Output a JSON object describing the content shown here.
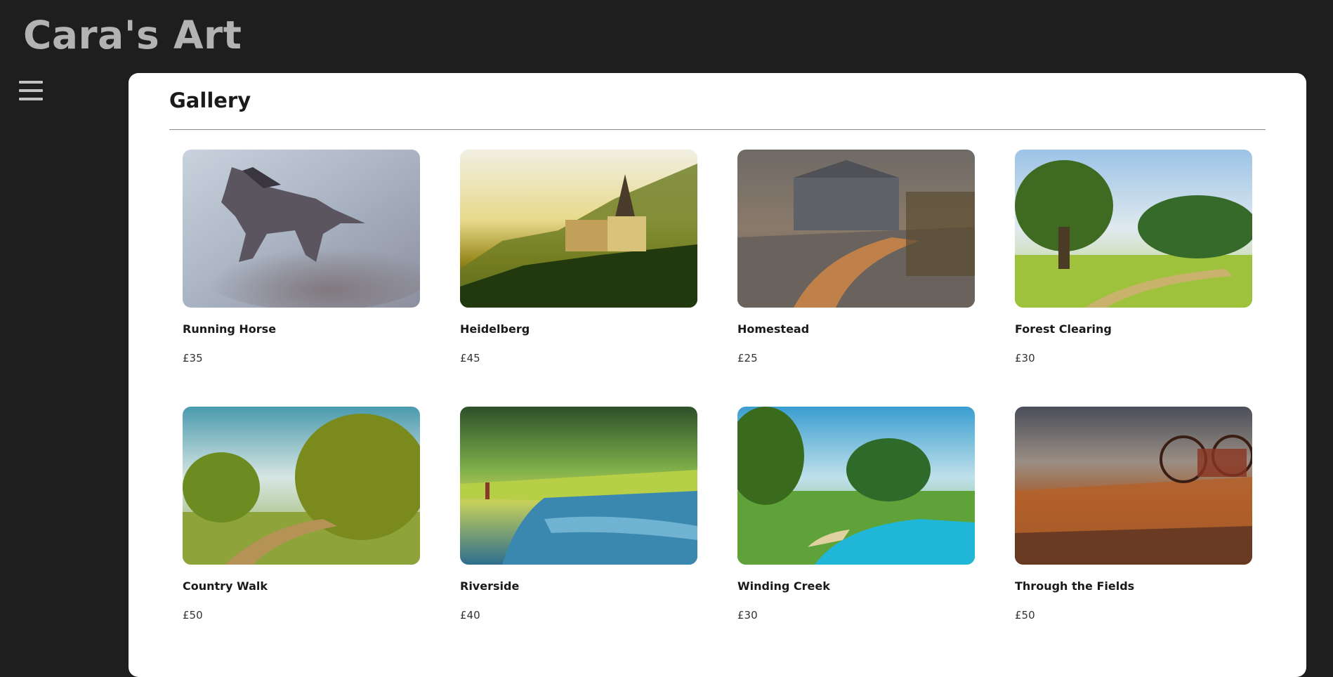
{
  "site": {
    "title": "Cara's Art"
  },
  "nav": {
    "menu_icon": "hamburger-menu-icon"
  },
  "gallery": {
    "heading": "Gallery",
    "items": [
      {
        "title": "Running Horse",
        "price": "£35"
      },
      {
        "title": "Heidelberg",
        "price": "£45"
      },
      {
        "title": "Homestead",
        "price": "£25"
      },
      {
        "title": "Forest Clearing",
        "price": "£30"
      },
      {
        "title": "Country Walk",
        "price": "£50"
      },
      {
        "title": "Riverside",
        "price": "£40"
      },
      {
        "title": "Winding Creek",
        "price": "£30"
      },
      {
        "title": "Through the Fields",
        "price": "£50"
      }
    ]
  },
  "colors": {
    "page_background": "#1e1e1e",
    "header_text": "#b3b3b3",
    "panel_background": "#ffffff"
  }
}
